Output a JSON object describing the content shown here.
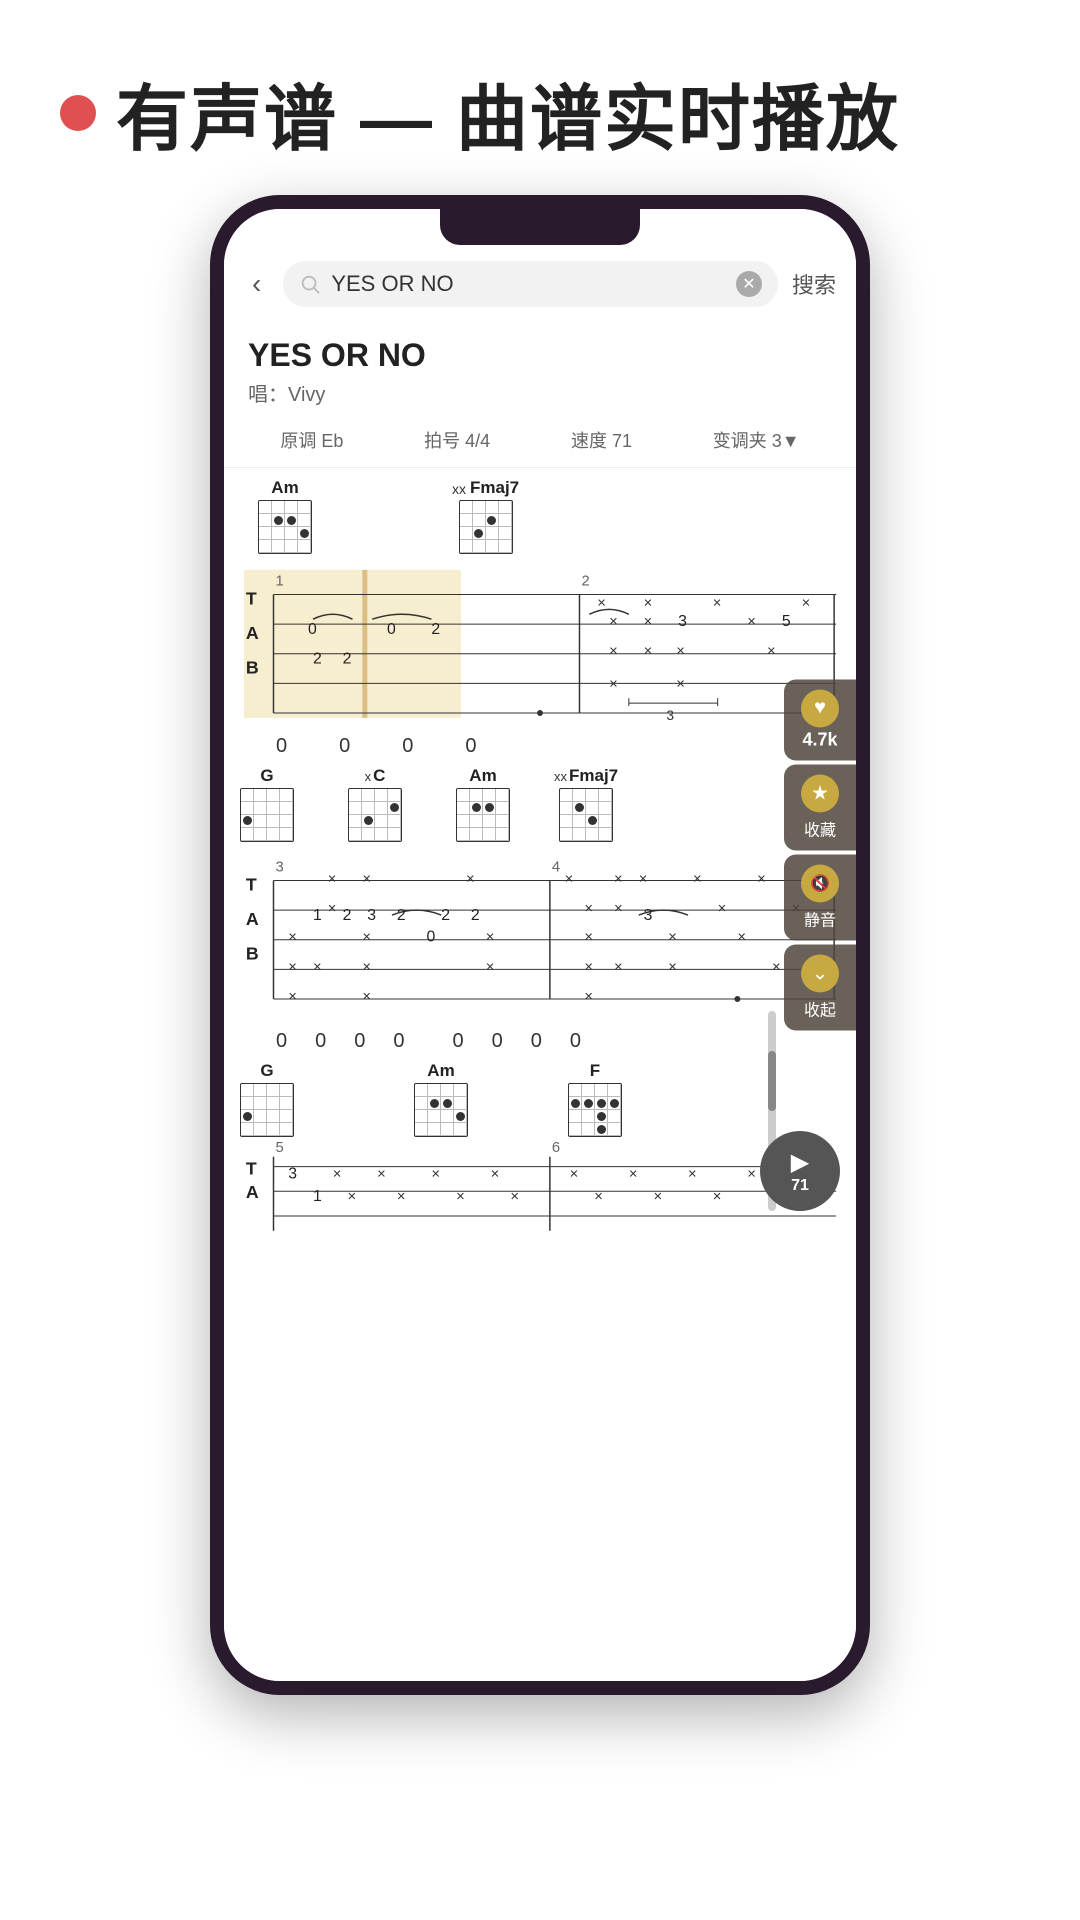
{
  "header": {
    "dot_color": "#e05050",
    "title": "有声谱 — 曲谱实时播放"
  },
  "search": {
    "query": "YES OR NO",
    "placeholder": "YES OR NO",
    "confirm_label": "搜索"
  },
  "song": {
    "title": "YES OR NO",
    "artist_label": "唱：Vivy",
    "original_key": "原调 Eb",
    "time_sig": "拍号 4/4",
    "tempo": "速度 71",
    "capo": "变调夹 3▼"
  },
  "chords_row1": [
    {
      "name": "Am",
      "mute": ""
    },
    {
      "name": "Fmaj7",
      "mute": "xx"
    }
  ],
  "chords_row2": [
    {
      "name": "G",
      "mute": ""
    },
    {
      "name": "C",
      "mute": "x"
    },
    {
      "name": "Am",
      "mute": ""
    },
    {
      "name": "Fmaj7",
      "mute": "xx"
    }
  ],
  "chords_row3": [
    {
      "name": "G",
      "mute": ""
    },
    {
      "name": "Am",
      "mute": ""
    },
    {
      "name": "F",
      "mute": ""
    }
  ],
  "measures": {
    "row1_nums": [
      "0",
      "0",
      "0",
      "0"
    ],
    "row2_nums": [
      "0",
      "0",
      "0 0",
      "0",
      "0",
      "0",
      "0"
    ]
  },
  "float_controls": [
    {
      "id": "like",
      "icon": "♥",
      "count": "4.7k",
      "label": ""
    },
    {
      "id": "collect",
      "icon": "★",
      "label": "收藏"
    },
    {
      "id": "mute",
      "icon": "🔇",
      "label": "静音"
    },
    {
      "id": "collapse",
      "icon": "⌄",
      "label": "收起"
    }
  ],
  "play_btn": {
    "icon": "▶",
    "bpm": "71"
  },
  "measure_labels": [
    "1",
    "2",
    "3",
    "4",
    "5",
    "6"
  ]
}
